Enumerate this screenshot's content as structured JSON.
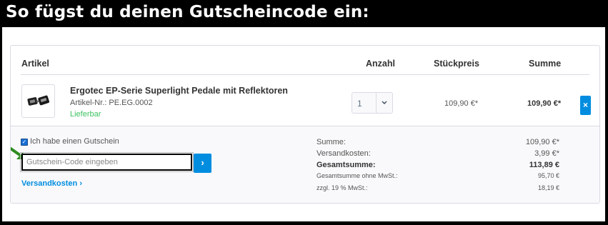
{
  "banner": {
    "title": "So fügst du deinen Gutscheincode ein:"
  },
  "cart": {
    "headers": {
      "article": "Artikel",
      "quantity": "Anzahl",
      "unit_price": "Stückpreis",
      "total": "Summe"
    },
    "item": {
      "name": "Ergotec EP-Serie Superlight Pedale mit Reflektoren",
      "sku_label": "Artikel-Nr.:",
      "sku": "PE.EG.0002",
      "availability": "Lieferbar",
      "quantity": "1",
      "unit_price": "109,90 €*",
      "line_total": "109,90 €*",
      "remove_label": "×"
    },
    "voucher": {
      "checkbox_label": "Ich habe einen Gutschein",
      "checked": true,
      "input_placeholder": "Gutschein-Code eingeben",
      "submit_label": "›"
    },
    "shipping_link": "Versandkosten ›",
    "summary": [
      {
        "label": "Summe:",
        "value": "109,90 €*"
      },
      {
        "label": "Versandkosten:",
        "value": "3,99 €*"
      },
      {
        "label": "Gesamtsumme:",
        "value": "113,89 €"
      },
      {
        "label": "Gesamtsumme ohne MwSt.:",
        "value": "95,70 €"
      },
      {
        "label": "zzgl. 19 % MwSt.:",
        "value": "18,19 €"
      }
    ]
  },
  "colors": {
    "accent": "#008ddf",
    "stock": "#3cc261",
    "arrow": "#2e8b1f",
    "border": "#dadae5"
  },
  "icons": {
    "remove": "close-icon",
    "submit": "chevron-right-icon",
    "quantity": "chevron-down-icon",
    "pointer": "arrow-icon"
  }
}
